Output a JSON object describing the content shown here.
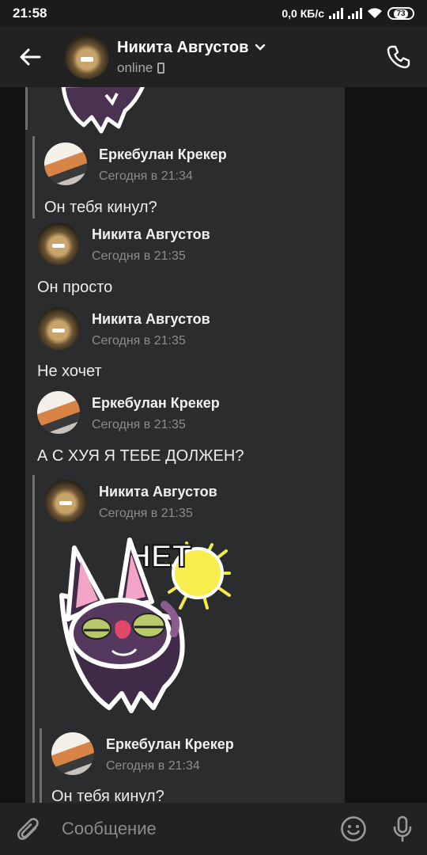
{
  "status_bar": {
    "time": "21:58",
    "net_speed": "0,0 КБ/с",
    "battery": "73"
  },
  "header": {
    "name": "Никита Августов",
    "status": "online"
  },
  "messages": [
    {
      "author": "Еркебулан Крекер",
      "time": "Сегодня в 21:34",
      "text": "Он тебя кинул?"
    },
    {
      "author": "Никита Августов",
      "time": "Сегодня в 21:35",
      "text": "Он просто"
    },
    {
      "author": "Никита Августов",
      "time": "Сегодня в 21:35",
      "text": "Не хочет"
    },
    {
      "author": "Еркебулан Крекер",
      "time": "Сегодня в 21:35",
      "text": "А С ХУЯ Я ТЕБЕ ДОЛЖЕН?"
    },
    {
      "author": "Никита Августов",
      "time": "Сегодня в 21:35",
      "sticker_text": "НЕТ"
    },
    {
      "author": "Еркебулан Крекер",
      "time": "Сегодня в 21:34",
      "text": "Он тебя кинул?"
    }
  ],
  "input": {
    "placeholder": "Сообщение"
  },
  "colors": {
    "background": "#121212",
    "card": "#2b2c2e",
    "bar": "#222222",
    "sun": "#f5e94a"
  }
}
